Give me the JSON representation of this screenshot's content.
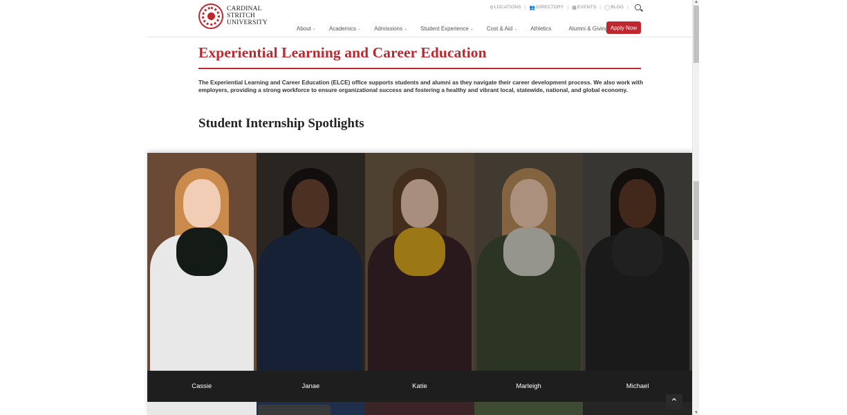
{
  "header": {
    "logo": {
      "line1": "CARDINAL",
      "line2": "STRITCH",
      "line3": "UNIVERSITY"
    },
    "utility": [
      {
        "icon": "map-pin-icon",
        "glyph": "⚲",
        "label": "LOCATIONS"
      },
      {
        "icon": "people-icon",
        "glyph": "👥",
        "label": "DIRECTORY"
      },
      {
        "icon": "calendar-icon",
        "glyph": "▦",
        "label": "EVENTS"
      },
      {
        "icon": "comment-icon",
        "glyph": "◯",
        "label": "BLOG"
      }
    ],
    "nav": [
      {
        "label": "About",
        "caret": "⌄"
      },
      {
        "label": "Academics",
        "caret": "⌄"
      },
      {
        "label": "Admissions",
        "caret": "⌄"
      },
      {
        "label": "Student Experience",
        "caret": "⌄"
      },
      {
        "label": "Cost & Aid",
        "caret": "⌄"
      },
      {
        "label": "Athletics",
        "caret": ""
      },
      {
        "label": "Alumni & Giving",
        "caret": "⌄"
      }
    ],
    "apply_label": "Apply Now"
  },
  "main": {
    "title": "Experiential Learning and Career Education",
    "intro": "The Experiential Learning and Career Education (ELCE) office supports students and alumni as they navigate their career development process. We also work with employers, providing a strong workforce to ensure organizational success and fostering a healthy and vibrant local, statewide, national, and global economy.",
    "spotlights_heading": "Student Internship Spotlights"
  },
  "gallery": {
    "students": [
      {
        "name": "Cassie",
        "bg": "#6b4a35",
        "hair": "#c98a4b",
        "skin": "#f1cdb6",
        "top": "#e8e8e8",
        "accent": "#141a16"
      },
      {
        "name": "Janae",
        "bg": "#3a3530",
        "hair": "#1a1412",
        "skin": "#6a4431",
        "top": "#1f2e4a",
        "accent": "#1f2e4a"
      },
      {
        "name": "Katie",
        "bg": "#6e5a45",
        "hair": "#5e3f28",
        "skin": "#e9c7ae",
        "top": "#3b2328",
        "accent": "#d9a51f"
      },
      {
        "name": "Marleigh",
        "bg": "#5a5145",
        "hair": "#b88a5a",
        "skin": "#edc9ad",
        "top": "#3e4a32",
        "accent": "#cfcfc5"
      },
      {
        "name": "Michael",
        "bg": "#4e4b47",
        "hair": "#1a1512",
        "skin": "#5a3826",
        "top": "#252525",
        "accent": "#2d2d2d"
      }
    ]
  },
  "controls": {
    "scroll_top_glyph": "⌃"
  },
  "colors": {
    "brand": "#c0262d",
    "namebar": "#1e1e1e"
  }
}
